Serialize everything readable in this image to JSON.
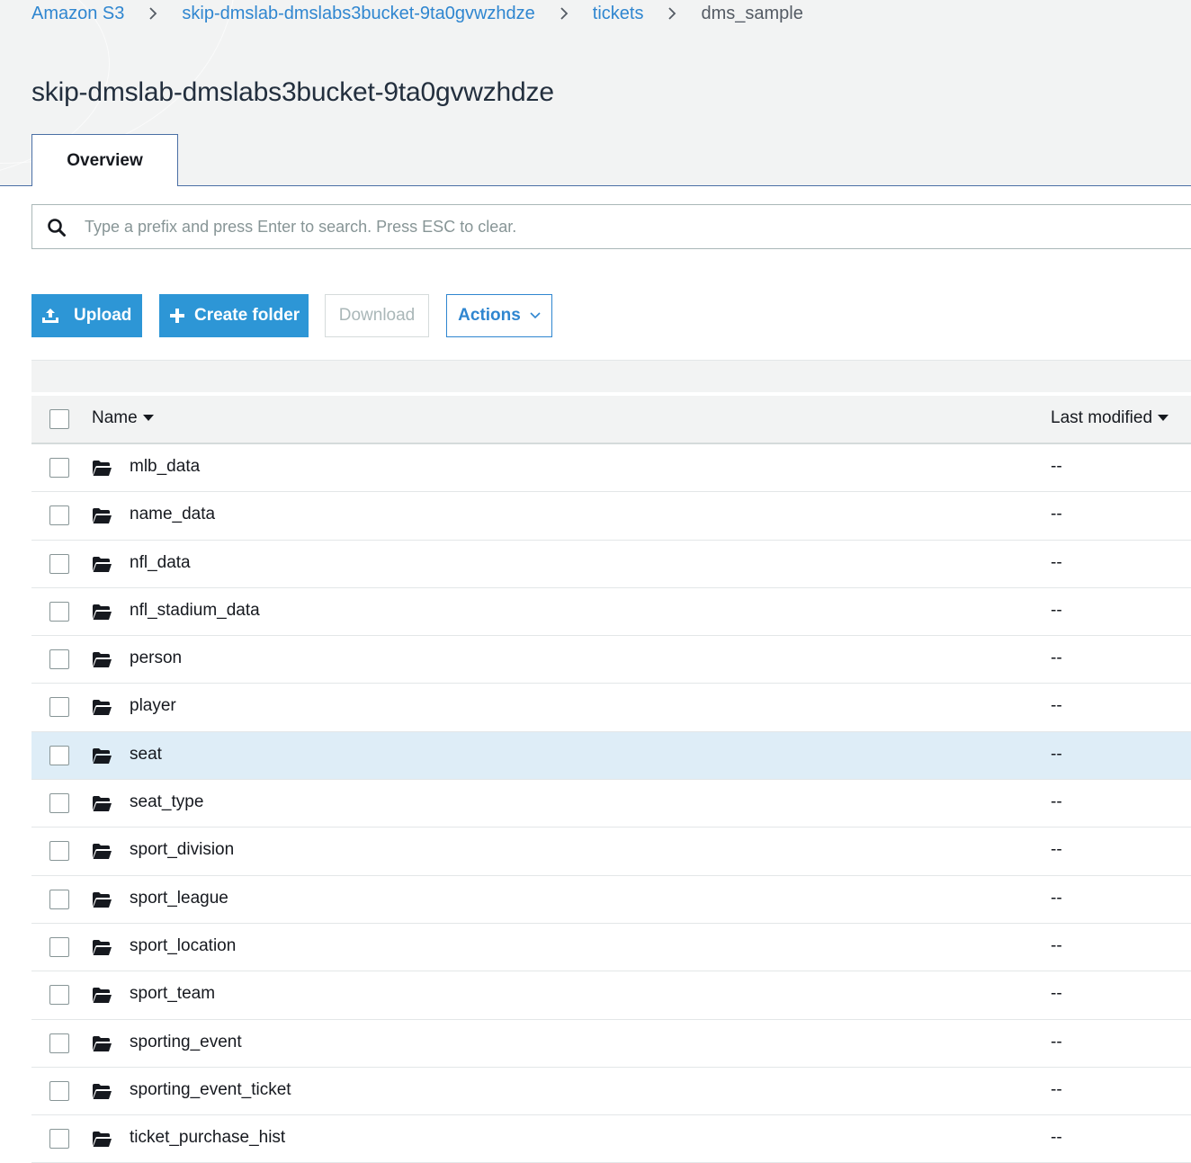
{
  "breadcrumb": {
    "root": "Amazon S3",
    "bucket": "skip-dmslab-dmslabs3bucket-9ta0gvwzhdze",
    "folder": "tickets",
    "current": "dms_sample"
  },
  "page": {
    "title": "skip-dmslab-dmslabs3bucket-9ta0gvwzhdze"
  },
  "tabs": {
    "overview": "Overview"
  },
  "search": {
    "placeholder": "Type a prefix and press Enter to search. Press ESC to clear."
  },
  "toolbar": {
    "upload": "Upload",
    "create_folder": "Create folder",
    "download": "Download",
    "actions": "Actions"
  },
  "table": {
    "columns": {
      "name": "Name",
      "last_modified": "Last modified"
    },
    "rows": [
      {
        "name": "mlb_data",
        "last_modified": "--",
        "selected": false
      },
      {
        "name": "name_data",
        "last_modified": "--",
        "selected": false
      },
      {
        "name": "nfl_data",
        "last_modified": "--",
        "selected": false
      },
      {
        "name": "nfl_stadium_data",
        "last_modified": "--",
        "selected": false
      },
      {
        "name": "person",
        "last_modified": "--",
        "selected": false
      },
      {
        "name": "player",
        "last_modified": "--",
        "selected": false
      },
      {
        "name": "seat",
        "last_modified": "--",
        "selected": true
      },
      {
        "name": "seat_type",
        "last_modified": "--",
        "selected": false
      },
      {
        "name": "sport_division",
        "last_modified": "--",
        "selected": false
      },
      {
        "name": "sport_league",
        "last_modified": "--",
        "selected": false
      },
      {
        "name": "sport_location",
        "last_modified": "--",
        "selected": false
      },
      {
        "name": "sport_team",
        "last_modified": "--",
        "selected": false
      },
      {
        "name": "sporting_event",
        "last_modified": "--",
        "selected": false
      },
      {
        "name": "sporting_event_ticket",
        "last_modified": "--",
        "selected": false
      },
      {
        "name": "ticket_purchase_hist",
        "last_modified": "--",
        "selected": false
      }
    ]
  },
  "icons": {
    "search": "search-icon",
    "upload": "upload-icon",
    "create_folder": "plus-icon",
    "actions": "chevron-down-icon",
    "row": "folder-open-icon",
    "sort": "caret-down-icon"
  },
  "colors": {
    "link": "#2f86d0",
    "primary_button": "#2d96d6",
    "header_bg": "#f2f3f3",
    "selected_row": "#deedf7"
  }
}
